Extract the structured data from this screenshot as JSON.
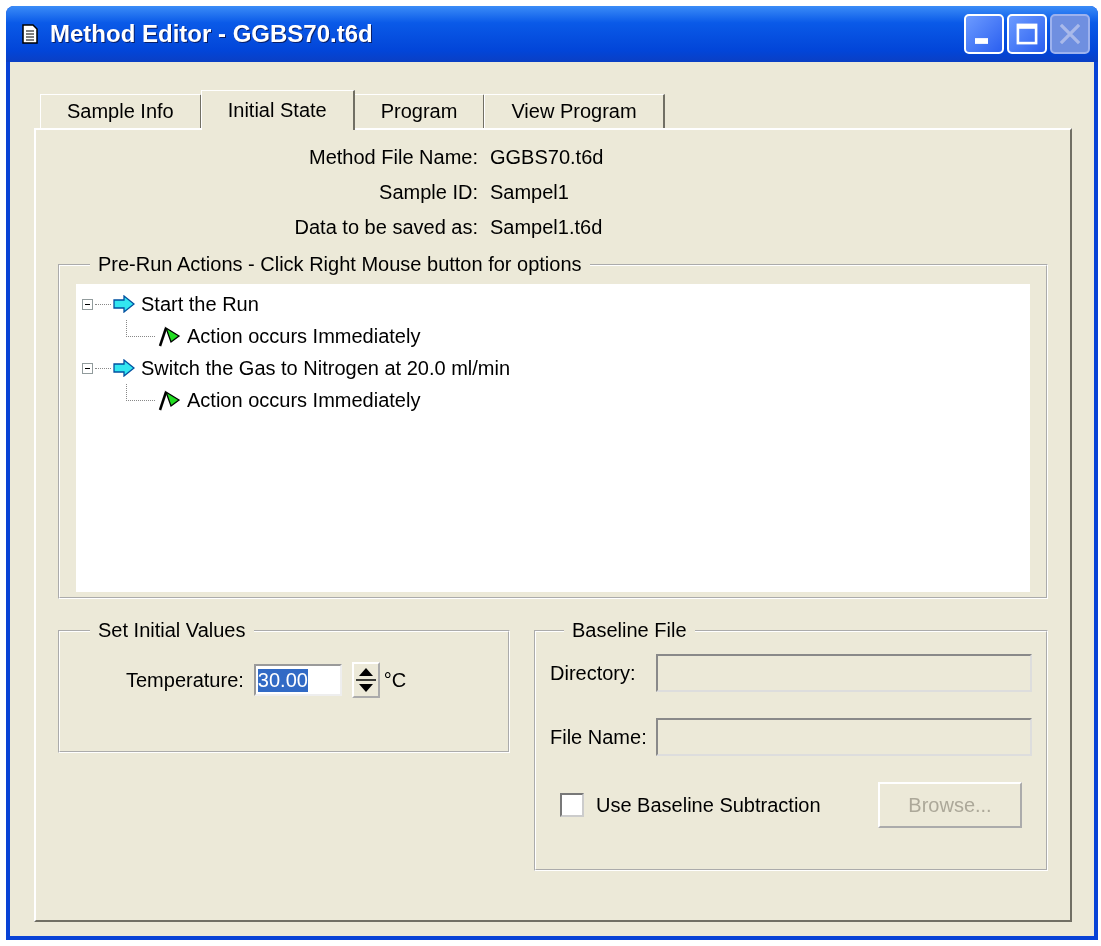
{
  "window": {
    "title": "Method Editor - GGBS70.t6d",
    "minimize_disabled": false,
    "maximize_disabled": false,
    "close_disabled": true
  },
  "tabs": [
    {
      "label": "Sample Info",
      "selected": false
    },
    {
      "label": "Initial State",
      "selected": true
    },
    {
      "label": "Program",
      "selected": false
    },
    {
      "label": "View Program",
      "selected": false
    }
  ],
  "info": [
    {
      "label": "Method File Name:",
      "value": "GGBS70.t6d"
    },
    {
      "label": "Sample ID:",
      "value": "Sampel1"
    },
    {
      "label": "Data to be saved as:",
      "value": "Sampel1.t6d"
    }
  ],
  "pre_run_actions": {
    "title": "Pre-Run Actions - Click Right Mouse button for options",
    "items": [
      {
        "kind": "action",
        "label": "Start the Run",
        "expanded": true,
        "children": [
          {
            "kind": "timing",
            "label": "Action occurs Immediately"
          }
        ]
      },
      {
        "kind": "action",
        "label": "Switch the Gas to Nitrogen at 20.0 ml/min",
        "expanded": true,
        "children": [
          {
            "kind": "timing",
            "label": "Action occurs Immediately"
          }
        ]
      }
    ]
  },
  "initial_values": {
    "title": "Set Initial Values",
    "label": "Temperature:",
    "value": "30.00",
    "value_highlighted": true,
    "unit": "°C"
  },
  "baseline_file": {
    "title": "Baseline File",
    "fields": [
      {
        "label": "Directory:",
        "disabled": true
      },
      {
        "label": "File Name:",
        "disabled": true
      }
    ],
    "checkbox": {
      "label": "Use Baseline Subtraction",
      "checked": false
    },
    "browse_button": {
      "label": "Browse...",
      "disabled": true
    }
  }
}
